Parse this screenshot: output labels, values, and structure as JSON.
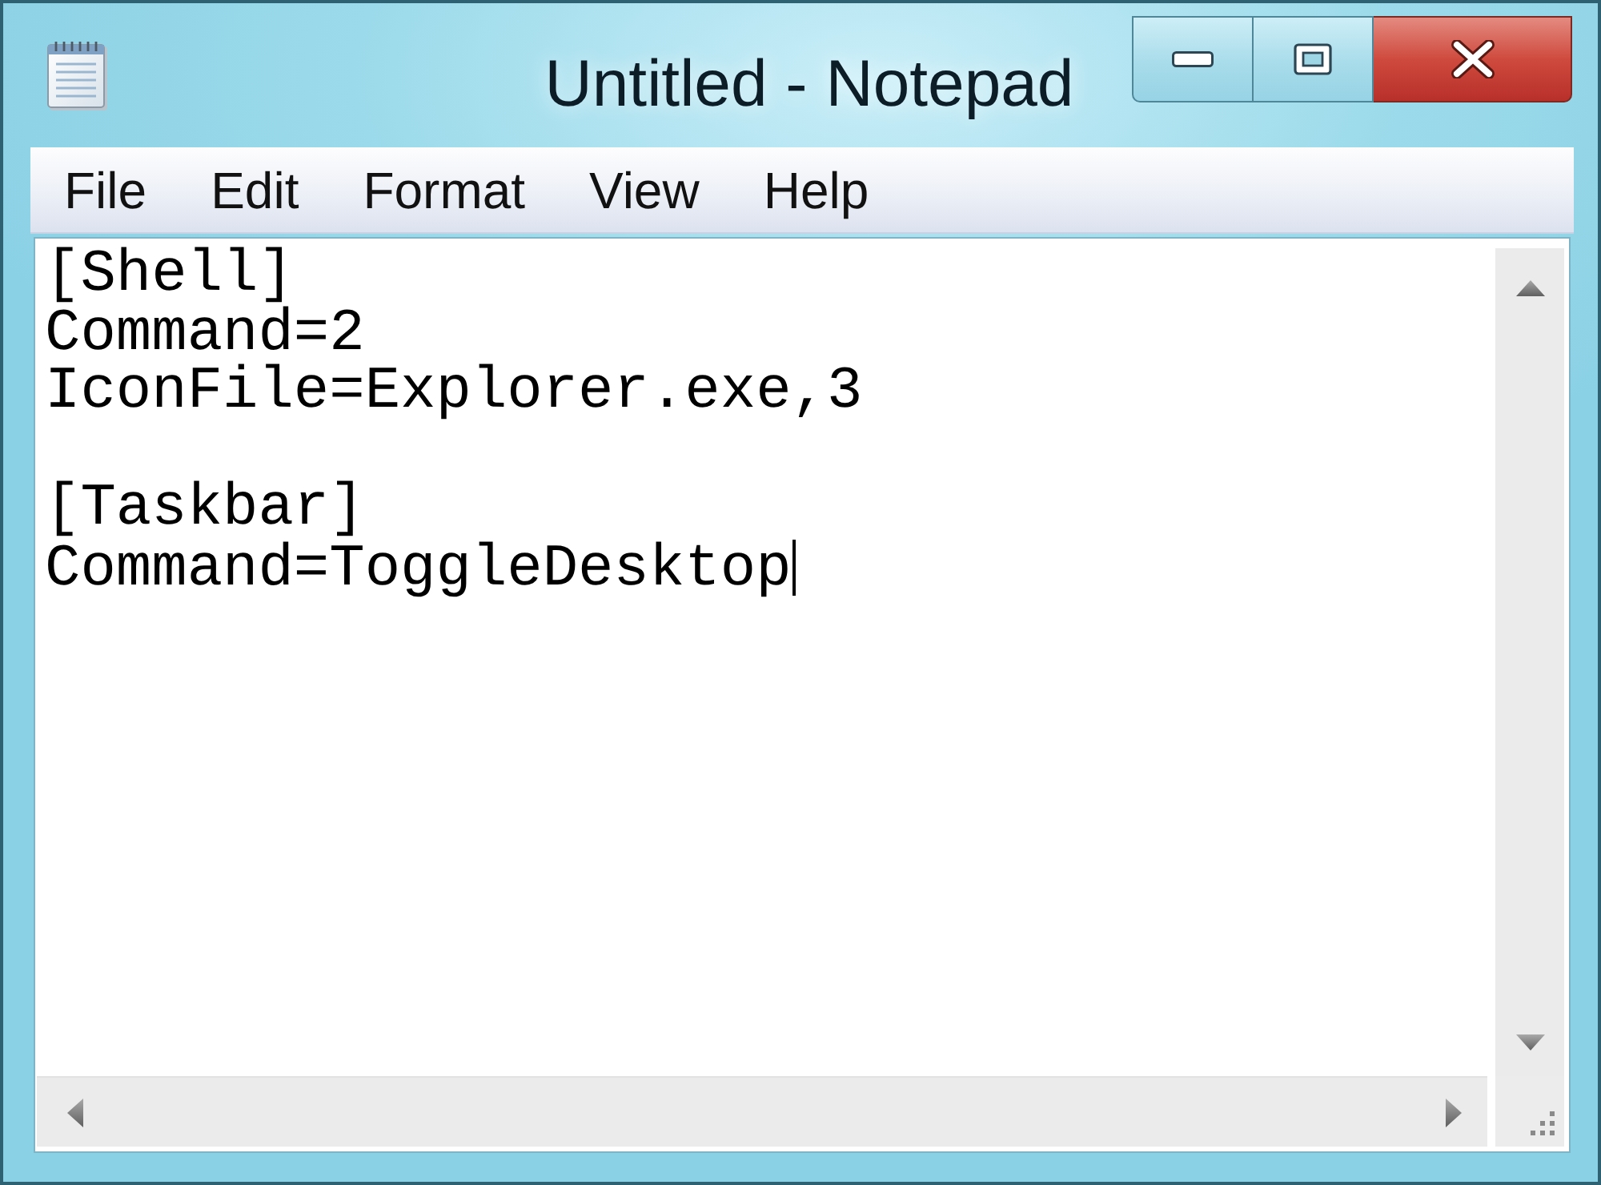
{
  "window": {
    "title": "Untitled - Notepad"
  },
  "menu_bar": {
    "items": [
      "File",
      "Edit",
      "Format",
      "View",
      "Help"
    ]
  },
  "editor": {
    "content": "[Shell]\nCommand=2\nIconFile=Explorer.exe,3\n\n[Taskbar]\nCommand=ToggleDesktop",
    "focused": true
  }
}
